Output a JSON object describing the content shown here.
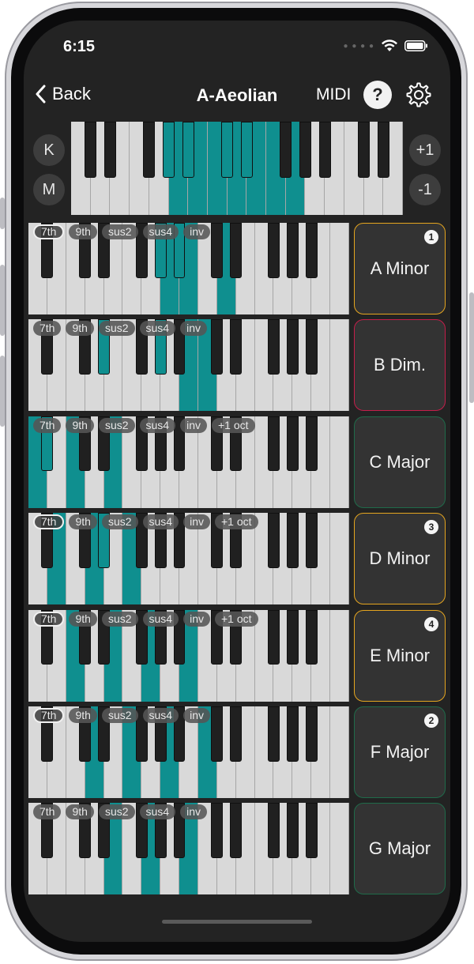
{
  "status": {
    "time": "6:15"
  },
  "nav": {
    "back_label": "Back",
    "title": "A-Aeolian",
    "midi_label": "MIDI",
    "help_label": "?"
  },
  "side_buttons": {
    "k": "K",
    "m": "M",
    "plus": "+1",
    "minus": "-1"
  },
  "colors": {
    "accent": "#0f8f8f",
    "orange": "#e5a51f",
    "red": "#c41e4a",
    "green": "#1f6b4a"
  },
  "top_keyboard": {
    "highlighted_white": [
      5,
      6,
      7,
      8,
      9,
      10,
      11
    ],
    "highlighted_black": [
      3,
      4,
      5,
      6
    ]
  },
  "rows": [
    {
      "chips": [
        "7th",
        "9th",
        "sus2",
        "sus4",
        "inv"
      ],
      "selected_chip": "7th",
      "chord": "A Minor",
      "badge": "1",
      "border": "orange",
      "on_white": [
        7,
        8,
        10
      ],
      "on_black": [
        4,
        5
      ]
    },
    {
      "chips": [
        "7th",
        "9th",
        "sus2",
        "sus4",
        "inv"
      ],
      "selected_chip": "",
      "chord": "B Dim.",
      "badge": "",
      "border": "red",
      "on_white": [
        8,
        9
      ],
      "on_black": [
        2,
        4
      ]
    },
    {
      "chips": [
        "7th",
        "9th",
        "sus2",
        "sus4",
        "inv",
        "+1 oct"
      ],
      "selected_chip": "",
      "chord": "C Major",
      "badge": "",
      "border": "green",
      "on_white": [
        0,
        2,
        4
      ],
      "on_black": [
        0
      ]
    },
    {
      "chips": [
        "7th",
        "9th",
        "sus2",
        "sus4",
        "inv",
        "+1 oct"
      ],
      "selected_chip": "7th",
      "chord": "D Minor",
      "badge": "3",
      "border": "orange",
      "on_white": [
        1,
        3,
        5
      ],
      "on_black": [
        2
      ]
    },
    {
      "chips": [
        "7th",
        "9th",
        "sus2",
        "sus4",
        "inv",
        "+1 oct"
      ],
      "selected_chip": "7th",
      "chord": "E Minor",
      "badge": "4",
      "border": "orange",
      "on_white": [
        2,
        4,
        6,
        8
      ],
      "on_black": []
    },
    {
      "chips": [
        "7th",
        "9th",
        "sus2",
        "sus4",
        "inv"
      ],
      "selected_chip": "7th",
      "chord": "F Major",
      "badge": "2",
      "border": "green",
      "on_white": [
        3,
        5,
        7,
        9
      ],
      "on_black": []
    },
    {
      "chips": [
        "7th",
        "9th",
        "sus2",
        "sus4",
        "inv"
      ],
      "selected_chip": "",
      "chord": "G Major",
      "badge": "",
      "border": "green",
      "on_white": [
        4,
        6,
        8
      ],
      "on_black": []
    }
  ]
}
